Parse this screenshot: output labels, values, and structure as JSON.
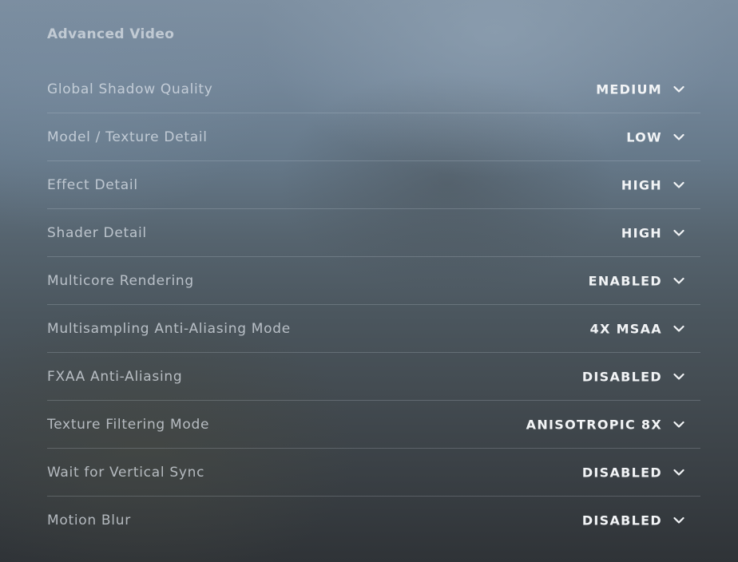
{
  "section": {
    "title": "Advanced Video"
  },
  "settings": [
    {
      "label": "Global Shadow Quality",
      "value": "MEDIUM",
      "icon": "chevron-down-icon"
    },
    {
      "label": "Model / Texture Detail",
      "value": "LOW",
      "icon": "chevron-down-icon"
    },
    {
      "label": "Effect Detail",
      "value": "HIGH",
      "icon": "chevron-down-icon"
    },
    {
      "label": "Shader Detail",
      "value": "HIGH",
      "icon": "chevron-down-icon"
    },
    {
      "label": "Multicore Rendering",
      "value": "ENABLED",
      "icon": "chevron-down-icon"
    },
    {
      "label": "Multisampling Anti-Aliasing Mode",
      "value": "4X MSAA",
      "icon": "chevron-down-icon"
    },
    {
      "label": "FXAA Anti-Aliasing",
      "value": "DISABLED",
      "icon": "chevron-down-icon"
    },
    {
      "label": "Texture Filtering Mode",
      "value": "ANISOTROPIC 8X",
      "icon": "chevron-down-icon"
    },
    {
      "label": "Wait for Vertical Sync",
      "value": "DISABLED",
      "icon": "chevron-down-icon"
    },
    {
      "label": "Motion Blur",
      "value": "DISABLED",
      "icon": "chevron-down-icon"
    }
  ],
  "colors": {
    "label_text": "#e2e8ee",
    "value_text": "#f2f4f6",
    "divider": "#d2dae2"
  }
}
